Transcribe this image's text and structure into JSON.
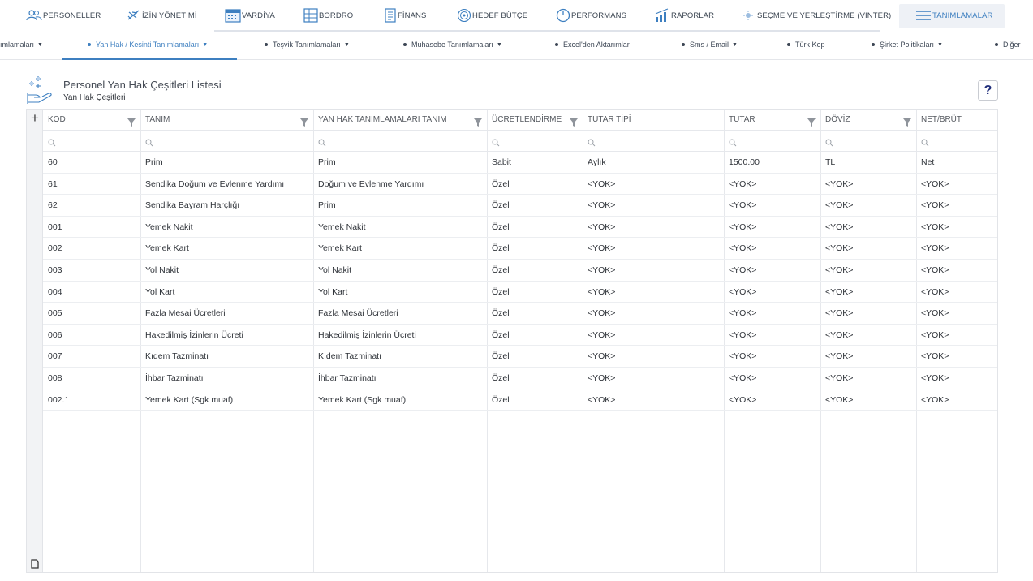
{
  "topnav": {
    "items": [
      {
        "label": "PERSONELLER",
        "icon": "people-icon"
      },
      {
        "label": "İZİN YÖNETİMİ",
        "icon": "plane-icon"
      },
      {
        "label": "VARDİYA",
        "icon": "calendar-icon"
      },
      {
        "label": "BORDRO",
        "icon": "grid-icon"
      },
      {
        "label": "FİNANS",
        "icon": "document-icon"
      },
      {
        "label": "HEDEF BÜTÇE",
        "icon": "target-icon"
      },
      {
        "label": "PERFORMANS",
        "icon": "gauge-icon"
      },
      {
        "label": "RAPORLAR",
        "icon": "bar-chart-icon"
      },
      {
        "label": "SEÇME VE YERLEŞTİRME (VINTER)",
        "icon": "sparkle-icon"
      },
      {
        "label": "TANIMLAMALAR",
        "icon": "hamburger-icon"
      }
    ],
    "active_index": 9
  },
  "subnav": {
    "items": [
      {
        "label": "ımlamaları",
        "caret": true
      },
      {
        "label": "Yan Hak / Kesinti Tanımlamaları",
        "caret": true
      },
      {
        "label": "Teşvik Tanımlamaları",
        "caret": true
      },
      {
        "label": "Muhasebe Tanımlamaları",
        "caret": true
      },
      {
        "label": "Excel'den Aktarımlar",
        "caret": false
      },
      {
        "label": "Sms / Email",
        "caret": true
      },
      {
        "label": "Türk Kep",
        "caret": false
      },
      {
        "label": "Şirket Politikaları",
        "caret": true
      },
      {
        "label": "Diğer",
        "caret": false
      }
    ],
    "active_index": 1,
    "caret_glyph": "▼"
  },
  "page": {
    "title": "Personel Yan Hak Çeşitleri Listesi",
    "subtitle": "Yan Hak Çeşitleri",
    "help_label": "?"
  },
  "grid": {
    "add_label": "+",
    "columns": [
      "KOD",
      "TANIM",
      "YAN HAK TANIMLAMALARI TANIM",
      "ÜCRETLENDİRME",
      "TUTAR TİPİ",
      "TUTAR",
      "DÖVİZ",
      "NET/BRÜT"
    ],
    "rows": [
      [
        "60",
        "Prim",
        "Prim",
        "Sabit",
        "Aylık",
        "1500.00",
        "TL",
        "Net"
      ],
      [
        "61",
        "Sendika Doğum ve Evlenme Yardımı",
        "Doğum ve Evlenme Yardımı",
        "Özel",
        "<YOK>",
        "<YOK>",
        "<YOK>",
        "<YOK>"
      ],
      [
        "62",
        "Sendika Bayram Harçlığı",
        "Prim",
        "Özel",
        "<YOK>",
        "<YOK>",
        "<YOK>",
        "<YOK>"
      ],
      [
        "001",
        "Yemek Nakit",
        "Yemek Nakit",
        "Özel",
        "<YOK>",
        "<YOK>",
        "<YOK>",
        "<YOK>"
      ],
      [
        "002",
        "Yemek Kart",
        "Yemek Kart",
        "Özel",
        "<YOK>",
        "<YOK>",
        "<YOK>",
        "<YOK>"
      ],
      [
        "003",
        "Yol Nakit",
        "Yol Nakit",
        "Özel",
        "<YOK>",
        "<YOK>",
        "<YOK>",
        "<YOK>"
      ],
      [
        "004",
        "Yol Kart",
        "Yol Kart",
        "Özel",
        "<YOK>",
        "<YOK>",
        "<YOK>",
        "<YOK>"
      ],
      [
        "005",
        "Fazla Mesai Ücretleri",
        "Fazla Mesai Ücretleri",
        "Özel",
        "<YOK>",
        "<YOK>",
        "<YOK>",
        "<YOK>"
      ],
      [
        "006",
        "Hakedilmiş İzinlerin Ücreti",
        "Hakedilmiş İzinlerin Ücreti",
        "Özel",
        "<YOK>",
        "<YOK>",
        "<YOK>",
        "<YOK>"
      ],
      [
        "007",
        "Kıdem Tazminatı",
        "Kıdem Tazminatı",
        "Özel",
        "<YOK>",
        "<YOK>",
        "<YOK>",
        "<YOK>"
      ],
      [
        "008",
        "İhbar Tazminatı",
        "İhbar Tazminatı",
        "Özel",
        "<YOK>",
        "<YOK>",
        "<YOK>",
        "<YOK>"
      ],
      [
        "002.1",
        "Yemek Kart (Sgk muaf)",
        "Yemek Kart (Sgk muaf)",
        "Özel",
        "<YOK>",
        "<YOK>",
        "<YOK>",
        "<YOK>"
      ]
    ]
  },
  "colors": {
    "accent": "#3d7fc0",
    "help_text": "#1f2d7a"
  }
}
